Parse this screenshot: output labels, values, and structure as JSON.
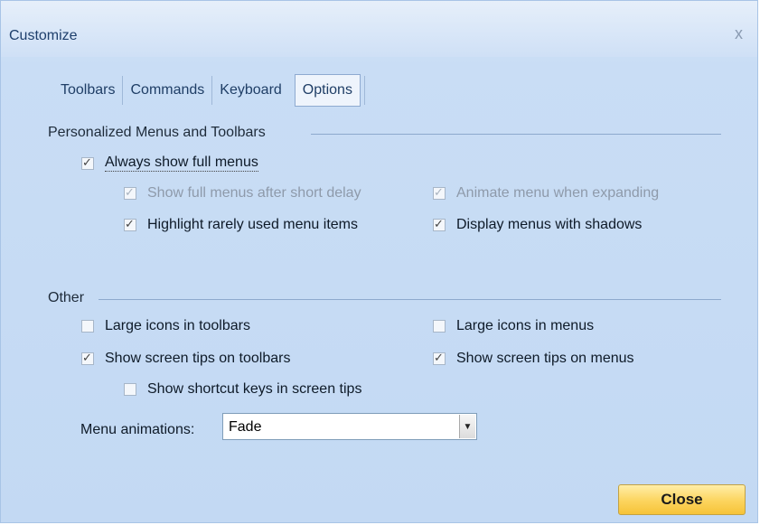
{
  "window": {
    "title": "Customize",
    "close_glyph": "x",
    "close_icon": "close-icon"
  },
  "tabs": [
    {
      "label": "Toolbars",
      "active": false
    },
    {
      "label": "Commands",
      "active": false
    },
    {
      "label": "Keyboard",
      "active": false
    },
    {
      "label": "Options",
      "active": true
    }
  ],
  "personalized": {
    "heading": "Personalized Menus and Toolbars",
    "always_show_full_menus": {
      "label": "Always show full menus",
      "checked": true
    },
    "show_full_after_delay": {
      "label": "Show full menus after short delay",
      "checked": true,
      "disabled": true
    },
    "animate_menu": {
      "label": "Animate menu when expanding",
      "checked": true,
      "disabled": true
    },
    "highlight_rarely_used": {
      "label": "Highlight rarely used menu items",
      "checked": true
    },
    "display_shadows": {
      "label": "Display menus with shadows",
      "checked": true
    }
  },
  "other": {
    "heading": "Other",
    "large_icons_toolbars": {
      "label": "Large icons in toolbars",
      "checked": false
    },
    "large_icons_menus": {
      "label": "Large icons in menus",
      "checked": false
    },
    "screen_tips_toolbars": {
      "label": "Show screen tips on toolbars",
      "checked": true
    },
    "screen_tips_menus": {
      "label": "Show screen tips on menus",
      "checked": true
    },
    "shortcut_keys_tips": {
      "label": "Show shortcut keys in screen tips",
      "checked": false
    },
    "menu_animations": {
      "label": "Menu animations:",
      "value": "Fade"
    }
  },
  "footer": {
    "close_label": "Close"
  },
  "colors": {
    "dialog_bg": "#c9ddf5",
    "accent_button": "#fcd45d"
  }
}
